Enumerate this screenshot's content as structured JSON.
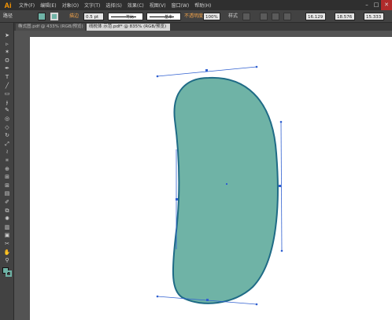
{
  "app": {
    "logo": "Ai"
  },
  "menu": [
    "文件(F)",
    "编辑(E)",
    "对象(O)",
    "文字(T)",
    "选择(S)",
    "效果(C)",
    "视图(V)",
    "窗口(W)",
    "帮助(H)"
  ],
  "window_controls": {
    "minimize": "–",
    "restore": "□",
    "close": "✕"
  },
  "control_bar": {
    "selection_label": "路径",
    "stroke_label": "描边",
    "stroke_weight": "0.5 pt",
    "variable_width": "等比",
    "brush": "基本",
    "opacity_label": "不透明度",
    "opacity_value": "100%",
    "style_label": "样式",
    "x_value": "16.129 m",
    "y_value": "18.576 m",
    "w_value": "15.333 m",
    "fill_color": "#6fb3a6",
    "accent_color": "#f0a24a"
  },
  "tabs": [
    {
      "label": "椭式图.pdf @ 433% (RGB/预览)",
      "active": false
    },
    {
      "label": "线枕体 示范.pdf* @ 835% (RGB/预览)",
      "active": true
    }
  ],
  "tools": [
    "select-arrow-icon",
    "direct-select-icon",
    "magic-wand-icon",
    "lasso-icon",
    "pen-icon",
    "type-icon",
    "line-icon",
    "rectangle-icon",
    "paintbrush-icon",
    "pencil-icon",
    "blob-brush-icon",
    "eraser-icon",
    "rotate-icon",
    "scale-icon",
    "width-icon",
    "free-transform-icon",
    "shape-builder-icon",
    "perspective-icon",
    "mesh-icon",
    "gradient-icon",
    "eyedropper-icon",
    "blend-icon",
    "symbol-sprayer-icon",
    "graph-icon",
    "artboard-icon",
    "slice-icon",
    "hand-icon",
    "zoom-icon"
  ],
  "tool_glyphs": [
    "➤",
    "▹",
    "✶",
    "ʘ",
    "✒",
    "T",
    "╱",
    "▭",
    "ɟ",
    "✎",
    "◎",
    "◇",
    "↻",
    "⤢",
    "≀",
    "⌗",
    "⊕",
    "⊞",
    "⊞",
    "▤",
    "✐",
    "⧉",
    "✺",
    "▥",
    "▣",
    "✂",
    "✋",
    "⚲"
  ],
  "shape": {
    "fill": "#6fb3a6",
    "stroke": "#1f6b86",
    "handle_color": "#2f5fd0"
  }
}
